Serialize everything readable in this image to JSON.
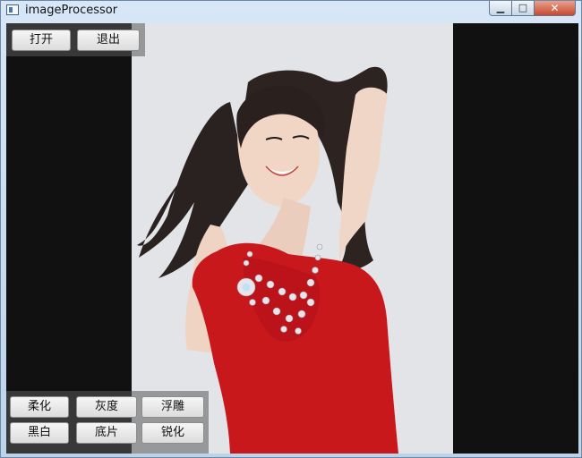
{
  "window": {
    "title": "imageProcessor",
    "controls": {
      "minimize_icon": "minimize-icon",
      "maximize_icon": "maximize-icon",
      "close_icon": "close-icon",
      "minimize_glyph": "▁",
      "maximize_glyph": "□",
      "close_glyph": "✕"
    }
  },
  "toolbar": {
    "open_label": "打开",
    "exit_label": "退出"
  },
  "filters": {
    "soften_label": "柔化",
    "grayscale_label": "灰度",
    "emboss_label": "浮雕",
    "black_white_label": "黑白",
    "negative_label": "底片",
    "sharpen_label": "锐化"
  },
  "canvas": {
    "image_subject": "portrait photo of a woman in a red dress with a crystal necklace",
    "background_color": "#111111",
    "button_panel_color": "#5a5a5a"
  }
}
